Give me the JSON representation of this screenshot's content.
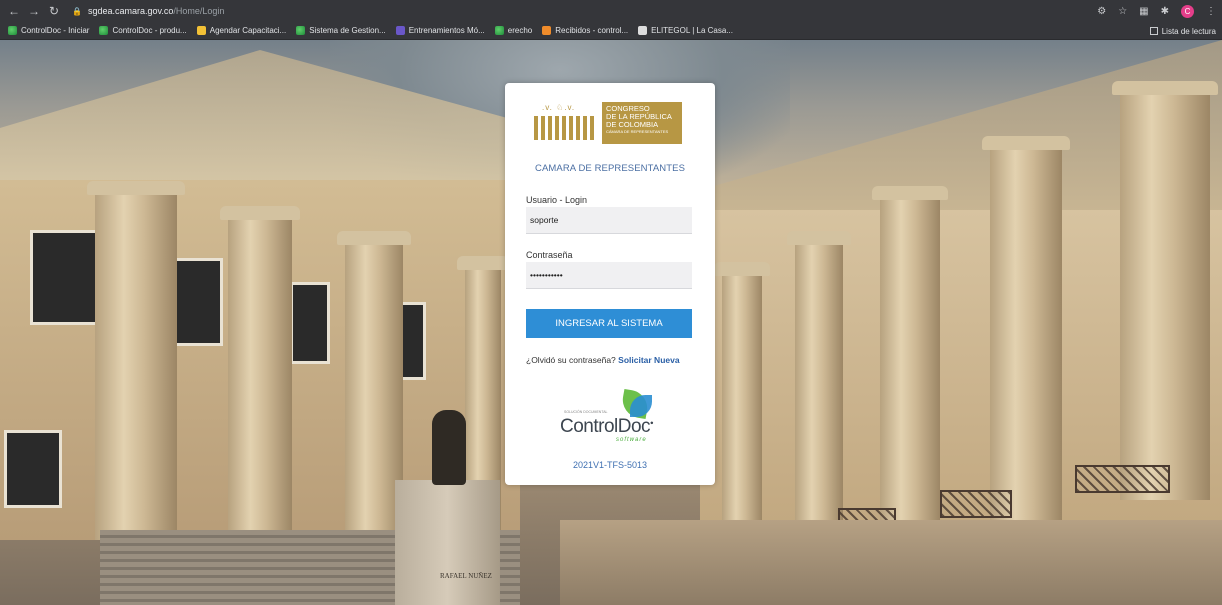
{
  "browser": {
    "url_host": "sgdea.camara.gov.co",
    "url_path": "/Home/Login",
    "avatar_letter": "C"
  },
  "bookmarks": [
    {
      "label": "ControlDoc - Iniciar",
      "icon": "controldoc-icon"
    },
    {
      "label": "ControlDoc - produ...",
      "icon": "controldoc-icon"
    },
    {
      "label": "Agendar Capacitaci...",
      "icon": "folder-icon"
    },
    {
      "label": "Sistema de Gestion...",
      "icon": "controldoc-icon"
    },
    {
      "label": "Entrenamientos Mó...",
      "icon": "list-icon"
    },
    {
      "label": "erecho",
      "icon": "controldoc-icon"
    },
    {
      "label": "Recibidos - control...",
      "icon": "inbox-icon"
    },
    {
      "label": "ELITEGOL | La Casa...",
      "icon": "elitegol-icon"
    }
  ],
  "reading_list": "Lista de lectura",
  "logo": {
    "stars": ".v. ♘.v.",
    "line1": "CONGRESO",
    "line2": "DE LA REPÚBLICA",
    "line3": "DE COLOMBIA",
    "line4": "CÁMARA DE REPRESENTANTES"
  },
  "login": {
    "chamber_title": "CAMARA DE REPRESENTANTES",
    "user_label": "Usuario - Login",
    "user_value": "soporte",
    "password_label": "Contraseña",
    "password_value": "•••••••••••",
    "submit_label": "INGRESAR AL SISTEMA",
    "forgot_text": "¿Olvidó su contraseña?",
    "forgot_link": "Solicitar Nueva"
  },
  "vendor": {
    "small_text": "SOLUCIÓN DOCUMENTAL",
    "name": "ControlDoc",
    "tagline": "software",
    "version": "2021V1-TFS-5013"
  },
  "background": {
    "pedestal_inscription": "RAFAEL NUÑEZ"
  },
  "colors": {
    "button": "#2e8ed6",
    "chamber_title": "#4b6fa3",
    "logo_gold": "#b79744",
    "version": "#3e6fb1"
  }
}
